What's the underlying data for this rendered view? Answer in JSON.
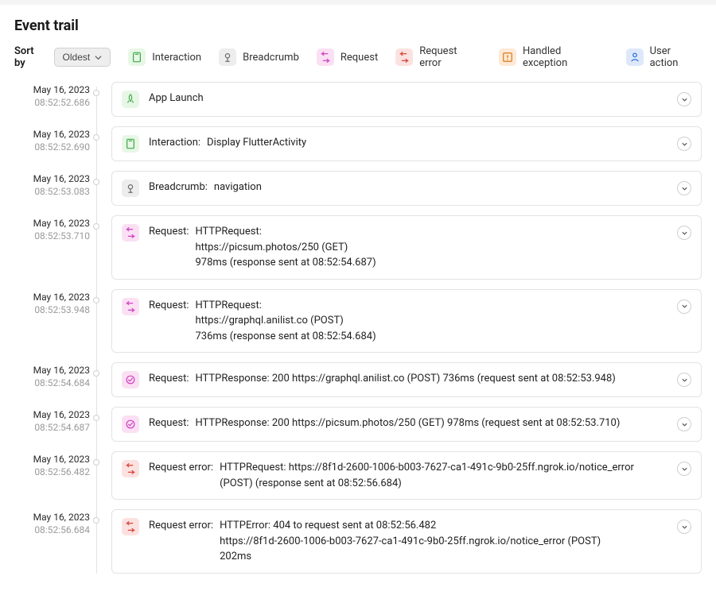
{
  "title": "Event trail",
  "sort": {
    "label": "Sort by",
    "value": "Oldest"
  },
  "legend": [
    {
      "icon": "interaction",
      "bg": "icon-green",
      "label": "Interaction"
    },
    {
      "icon": "breadcrumb",
      "bg": "icon-gray",
      "label": "Breadcrumb"
    },
    {
      "icon": "request",
      "bg": "icon-pink",
      "label": "Request"
    },
    {
      "icon": "reqerror",
      "bg": "icon-red",
      "label": "Request error"
    },
    {
      "icon": "handledexc",
      "bg": "icon-orange",
      "label": "Handled exception"
    },
    {
      "icon": "useraction",
      "bg": "icon-blue",
      "label": "User action"
    }
  ],
  "events": [
    {
      "date": "May 16, 2023",
      "time": "08:52:52.686",
      "icon": "launch",
      "bg": "icon-green",
      "label": "App Launch",
      "detail": []
    },
    {
      "date": "May 16, 2023",
      "time": "08:52:52.690",
      "icon": "interaction",
      "bg": "icon-green",
      "label": "Interaction:",
      "detail": [
        "Display FlutterActivity"
      ]
    },
    {
      "date": "May 16, 2023",
      "time": "08:52:53.083",
      "icon": "breadcrumb",
      "bg": "icon-gray",
      "label": "Breadcrumb:",
      "detail": [
        "navigation"
      ]
    },
    {
      "date": "May 16, 2023",
      "time": "08:52:53.710",
      "icon": "request",
      "bg": "icon-pink",
      "label": "Request:",
      "detail": [
        "HTTPRequest:",
        "https://picsum.photos/250 (GET)",
        "978ms (response sent at 08:52:54.687)"
      ]
    },
    {
      "date": "May 16, 2023",
      "time": "08:52:53.948",
      "icon": "request",
      "bg": "icon-pink",
      "label": "Request:",
      "detail": [
        "HTTPRequest:",
        "https://graphql.anilist.co (POST)",
        "736ms (response sent at 08:52:54.684)"
      ]
    },
    {
      "date": "May 16, 2023",
      "time": "08:52:54.684",
      "icon": "response",
      "bg": "icon-pink",
      "label": "Request:",
      "detail": [
        "HTTPResponse: 200 https://graphql.anilist.co (POST) 736ms (request sent at 08:52:53.948)"
      ]
    },
    {
      "date": "May 16, 2023",
      "time": "08:52:54.687",
      "icon": "response",
      "bg": "icon-pink",
      "label": "Request:",
      "detail": [
        "HTTPResponse: 200 https://picsum.photos/250 (GET) 978ms (request sent at 08:52:53.710)"
      ]
    },
    {
      "date": "May 16, 2023",
      "time": "08:52:56.482",
      "icon": "reqerror",
      "bg": "icon-red",
      "label": "Request error:",
      "detail": [
        "HTTPRequest: https://8f1d-2600-1006-b003-7627-ca1-491c-9b0-25ff.ngrok.io/notice_error (POST) (response sent at 08:52:56.684)"
      ]
    },
    {
      "date": "May 16, 2023",
      "time": "08:52:56.684",
      "icon": "reqerror",
      "bg": "icon-red",
      "label": "Request error:",
      "detail": [
        "HTTPError: 404 to request sent at 08:52:56.482",
        "https://8f1d-2600-1006-b003-7627-ca1-491c-9b0-25ff.ngrok.io/notice_error (POST)",
        "202ms"
      ]
    }
  ]
}
